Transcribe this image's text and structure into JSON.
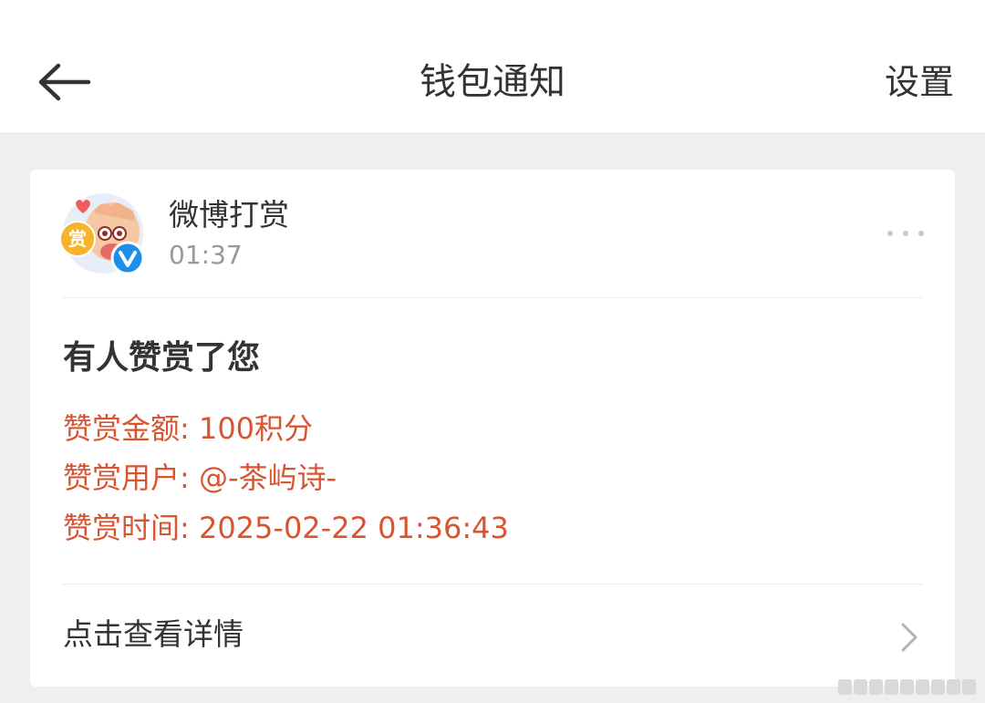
{
  "header": {
    "title": "钱包通知",
    "settings_label": "设置",
    "back_icon": "arrow-left-icon"
  },
  "notification": {
    "sender_name": "微博打赏",
    "sender_time": "01:37",
    "avatar_badge_text": "赏",
    "verified_badge_icon": "verified-v-icon",
    "more_icon": "more-dots-icon",
    "heading": "有人赞赏了您",
    "info_lines": [
      "赞赏金额: 100积分",
      "赞赏用户: @-茶屿诗-",
      "赞赏时间: 2025-02-22 01:36:43"
    ],
    "details_label": "点击查看详情",
    "details_icon": "chevron-right-icon"
  },
  "colors": {
    "accent_text": "#d95430",
    "verified_badge": "#1d8fe8"
  }
}
